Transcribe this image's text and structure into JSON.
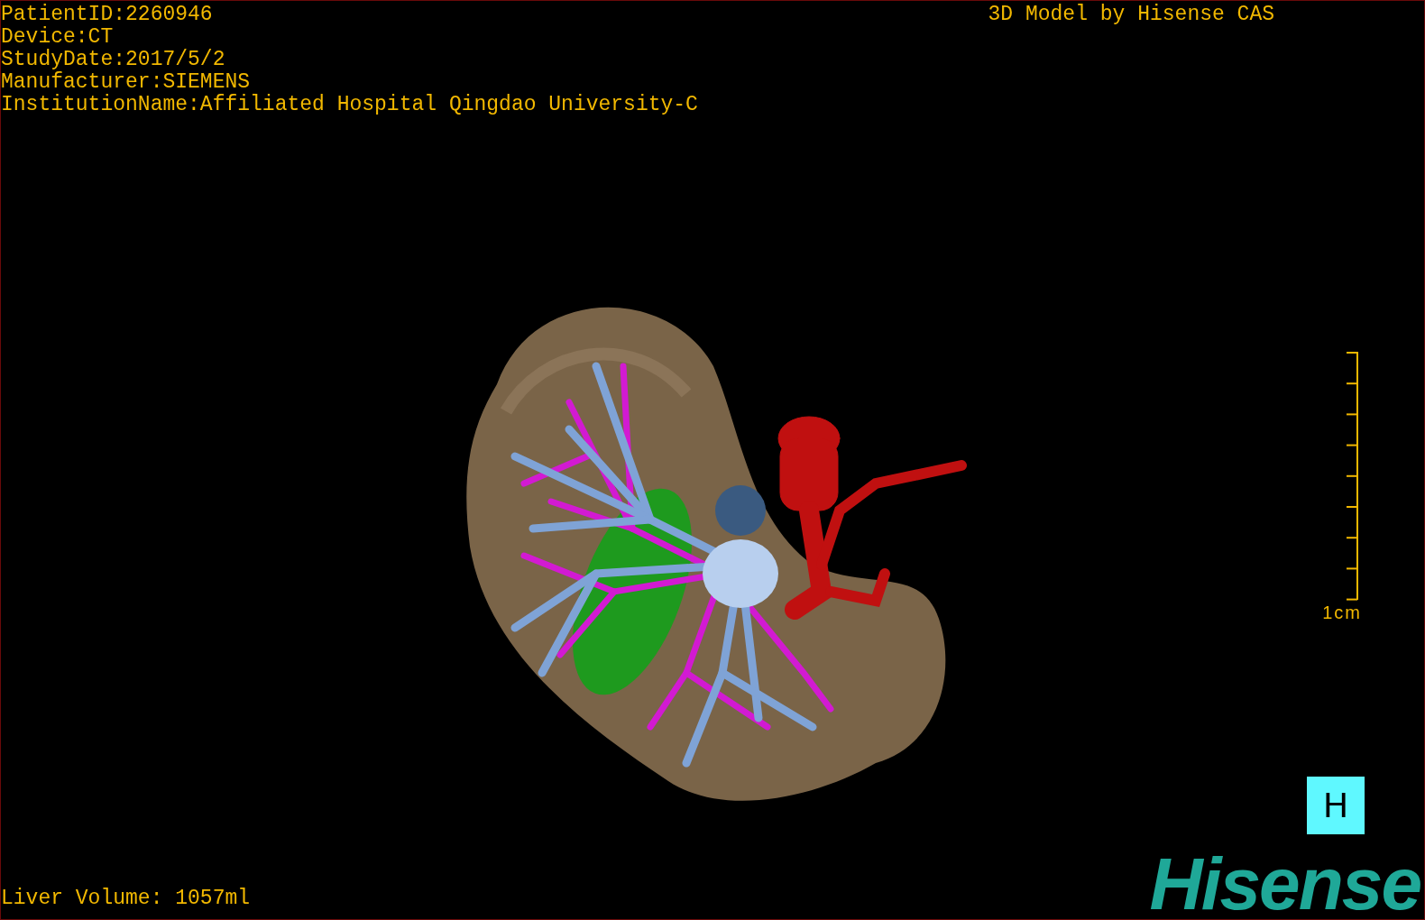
{
  "patient_info": [
    "PatientID:2260946",
    "Device:CT",
    "StudyDate:2017/5/2",
    "Manufacturer:SIEMENS",
    "InstitutionName:Affiliated Hospital Qingdao University-C"
  ],
  "caption": "3D Model by Hisense CAS",
  "scale_bar": {
    "label": "1cm"
  },
  "view_button": {
    "label": "H"
  },
  "brand_logo": "Hisense",
  "liver_volume": "Liver Volume: 1057ml"
}
